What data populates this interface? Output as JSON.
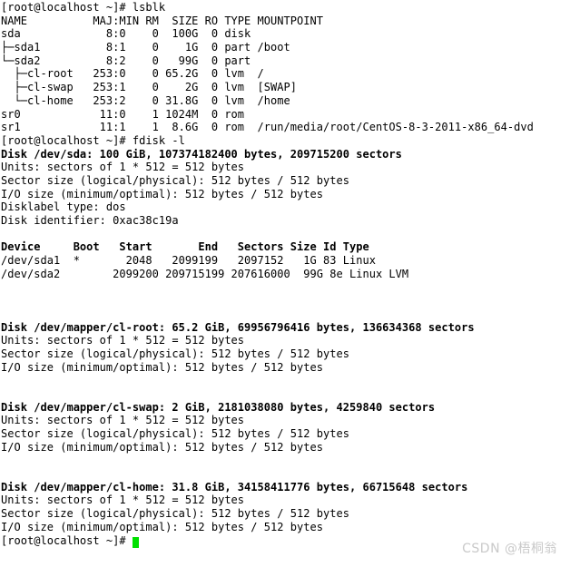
{
  "terminal": {
    "colors": {
      "background": "#ffffff",
      "foreground": "#000000",
      "cursor": "#00e000",
      "watermark": "#c9c9c9"
    },
    "prompt": "[root@localhost ~]#",
    "lines": [
      {
        "id": "prompt-lsblk",
        "text": "[root@localhost ~]# lsblk",
        "bold": false
      },
      {
        "id": "lsblk-header",
        "text": "NAME          MAJ:MIN RM  SIZE RO TYPE MOUNTPOINT",
        "bold": false
      },
      {
        "id": "lsblk-sda",
        "text": "sda             8:0    0  100G  0 disk",
        "bold": false
      },
      {
        "id": "lsblk-sda1",
        "text": "├─sda1          8:1    0    1G  0 part /boot",
        "bold": false
      },
      {
        "id": "lsblk-sda2",
        "text": "└─sda2          8:2    0   99G  0 part",
        "bold": false
      },
      {
        "id": "lsblk-cl-root",
        "text": "  ├─cl-root   253:0    0 65.2G  0 lvm  /",
        "bold": false
      },
      {
        "id": "lsblk-cl-swap",
        "text": "  ├─cl-swap   253:1    0    2G  0 lvm  [SWAP]",
        "bold": false
      },
      {
        "id": "lsblk-cl-home",
        "text": "  └─cl-home   253:2    0 31.8G  0 lvm  /home",
        "bold": false
      },
      {
        "id": "lsblk-sr0",
        "text": "sr0            11:0    1 1024M  0 rom",
        "bold": false
      },
      {
        "id": "lsblk-sr1",
        "text": "sr1            11:1    1  8.6G  0 rom  /run/media/root/CentOS-8-3-2011-x86_64-dvd",
        "bold": false
      },
      {
        "id": "prompt-fdisk",
        "text": "[root@localhost ~]# fdisk -l",
        "bold": false
      },
      {
        "id": "sda-disk",
        "text": "Disk /dev/sda: 100 GiB, 107374182400 bytes, 209715200 sectors",
        "bold": true
      },
      {
        "id": "sda-units",
        "text": "Units: sectors of 1 * 512 = 512 bytes",
        "bold": false
      },
      {
        "id": "sda-sector-size",
        "text": "Sector size (logical/physical): 512 bytes / 512 bytes",
        "bold": false
      },
      {
        "id": "sda-io-size",
        "text": "I/O size (minimum/optimal): 512 bytes / 512 bytes",
        "bold": false
      },
      {
        "id": "sda-disklabel",
        "text": "Disklabel type: dos",
        "bold": false
      },
      {
        "id": "sda-identifier",
        "text": "Disk identifier: 0xac38c19a",
        "bold": false
      },
      {
        "id": "blank-1",
        "text": "",
        "bold": false
      },
      {
        "id": "parttable-header",
        "text": "Device     Boot   Start       End   Sectors Size Id Type",
        "bold": true
      },
      {
        "id": "parttable-sda1",
        "text": "/dev/sda1  *       2048   2099199   2097152   1G 83 Linux",
        "bold": false
      },
      {
        "id": "parttable-sda2",
        "text": "/dev/sda2        2099200 209715199 207616000  99G 8e Linux LVM",
        "bold": false
      },
      {
        "id": "blank-2",
        "text": "",
        "bold": false
      },
      {
        "id": "blank-3",
        "text": "",
        "bold": false
      },
      {
        "id": "blank-4",
        "text": "",
        "bold": false
      },
      {
        "id": "clroot-disk",
        "text": "Disk /dev/mapper/cl-root: 65.2 GiB, 69956796416 bytes, 136634368 sectors",
        "bold": true
      },
      {
        "id": "clroot-units",
        "text": "Units: sectors of 1 * 512 = 512 bytes",
        "bold": false
      },
      {
        "id": "clroot-sector-size",
        "text": "Sector size (logical/physical): 512 bytes / 512 bytes",
        "bold": false
      },
      {
        "id": "clroot-io-size",
        "text": "I/O size (minimum/optimal): 512 bytes / 512 bytes",
        "bold": false
      },
      {
        "id": "blank-5",
        "text": "",
        "bold": false
      },
      {
        "id": "blank-6",
        "text": "",
        "bold": false
      },
      {
        "id": "clswap-disk",
        "text": "Disk /dev/mapper/cl-swap: 2 GiB, 2181038080 bytes, 4259840 sectors",
        "bold": true
      },
      {
        "id": "clswap-units",
        "text": "Units: sectors of 1 * 512 = 512 bytes",
        "bold": false
      },
      {
        "id": "clswap-sector-size",
        "text": "Sector size (logical/physical): 512 bytes / 512 bytes",
        "bold": false
      },
      {
        "id": "clswap-io-size",
        "text": "I/O size (minimum/optimal): 512 bytes / 512 bytes",
        "bold": false
      },
      {
        "id": "blank-7",
        "text": "",
        "bold": false
      },
      {
        "id": "blank-8",
        "text": "",
        "bold": false
      },
      {
        "id": "clhome-disk",
        "text": "Disk /dev/mapper/cl-home: 31.8 GiB, 34158411776 bytes, 66715648 sectors",
        "bold": true
      },
      {
        "id": "clhome-units",
        "text": "Units: sectors of 1 * 512 = 512 bytes",
        "bold": false
      },
      {
        "id": "clhome-sector-size",
        "text": "Sector size (logical/physical): 512 bytes / 512 bytes",
        "bold": false
      },
      {
        "id": "clhome-io-size",
        "text": "I/O size (minimum/optimal): 512 bytes / 512 bytes",
        "bold": false
      }
    ],
    "final_prompt": "[root@localhost ~]# "
  },
  "watermark": {
    "text": "CSDN @梧桐翁"
  }
}
